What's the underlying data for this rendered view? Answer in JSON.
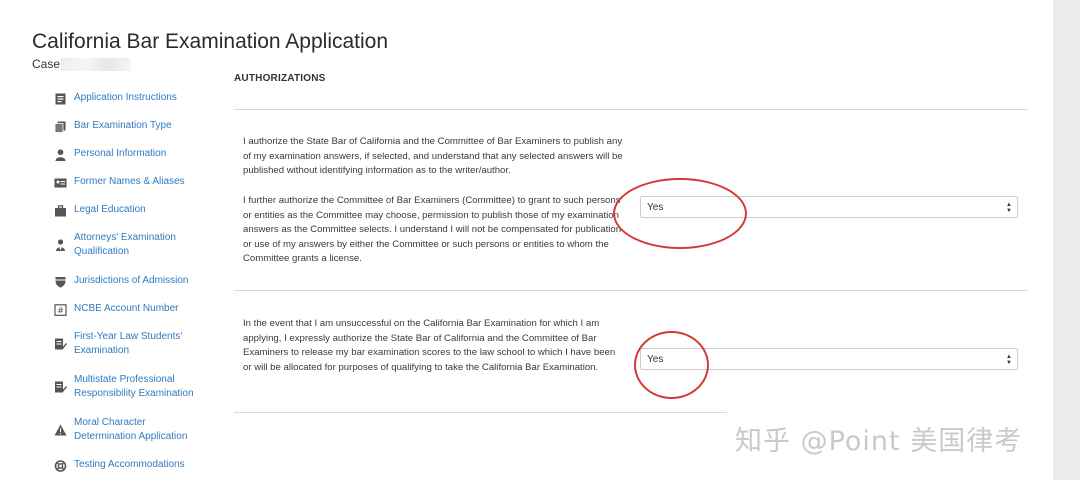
{
  "header": {
    "title": "California Bar Examination Application",
    "case_label": "Case"
  },
  "sidebar": {
    "items": [
      {
        "label": "Application Instructions",
        "icon": "document-list-icon"
      },
      {
        "label": "Bar Examination Type",
        "icon": "copy-files-icon"
      },
      {
        "label": "Personal Information",
        "icon": "person-icon"
      },
      {
        "label": "Former Names & Aliases",
        "icon": "id-card-icon"
      },
      {
        "label": "Legal Education",
        "icon": "briefcase-icon"
      },
      {
        "label": "Attorneys' Examination Qualification",
        "icon": "user-tie-icon"
      },
      {
        "label": "Jurisdictions of Admission",
        "icon": "shield-icon"
      },
      {
        "label": "NCBE Account Number",
        "icon": "hash-box-icon"
      },
      {
        "label": "First-Year Law Students' Examination",
        "icon": "edit-document-icon"
      },
      {
        "label": "Multistate Professional Responsibility Examination",
        "icon": "edit-document-icon"
      },
      {
        "label": "Moral Character Determination Application",
        "icon": "warning-icon"
      },
      {
        "label": "Testing Accommodations",
        "icon": "lifebuoy-icon"
      }
    ]
  },
  "main": {
    "section_title": "AUTHORIZATIONS",
    "paragraph1": "I authorize the State Bar of California and the Committee of Bar Examiners to publish any of my examination answers, if selected, and understand that any selected answers will be published without identifying information as to the writer/author.",
    "paragraph2": "I further authorize the Committee of Bar Examiners (Committee) to grant to such persons or entities as the Committee may choose, permission to publish those of my examination answers as the Committee selects. I understand I will not be compensated for publication or use of my answers by either the Committee or such persons or entities to whom the Committee grants a license.",
    "select1_value": "Yes",
    "paragraph3": "In the event that I am unsuccessful on the California Bar Examination for which I am applying, I expressly authorize the State Bar of California and the Committee of Bar Examiners to release my bar examination scores to the law school to which I have been or will be allocated for purposes of qualifying to take the California Bar Examination.",
    "select2_value": "Yes"
  },
  "watermark": "知乎 @Point 美国律考",
  "colors": {
    "link": "#2f7bbf",
    "annotation": "#d23a32"
  }
}
